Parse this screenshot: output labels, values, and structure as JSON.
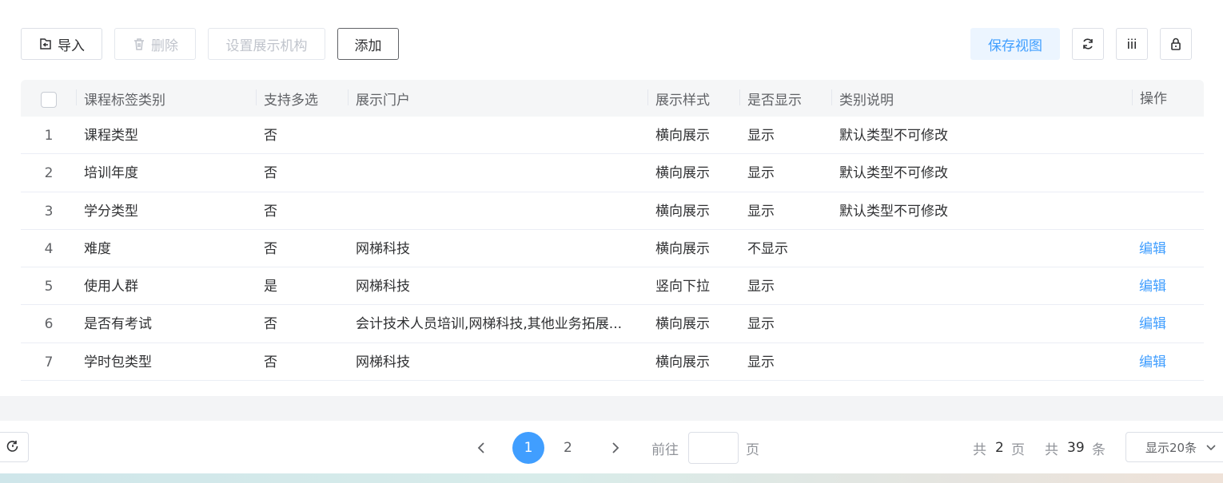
{
  "toolbar": {
    "import_label": "导入",
    "delete_label": "删除",
    "set_org_label": "设置展示机构",
    "add_label": "添加",
    "save_view_label": "保存视图"
  },
  "table": {
    "headers": {
      "category": "课程标签类别",
      "multi": "支持多选",
      "portal": "展示门户",
      "style": "展示样式",
      "display": "是否显示",
      "desc": "类别说明",
      "action": "操作"
    },
    "rows": [
      {
        "idx": "1",
        "category": "课程类型",
        "multi": "否",
        "portal": "",
        "style": "横向展示",
        "display": "显示",
        "desc": "默认类型不可修改",
        "action": ""
      },
      {
        "idx": "2",
        "category": "培训年度",
        "multi": "否",
        "portal": "",
        "style": "横向展示",
        "display": "显示",
        "desc": "默认类型不可修改",
        "action": ""
      },
      {
        "idx": "3",
        "category": "学分类型",
        "multi": "否",
        "portal": "",
        "style": "横向展示",
        "display": "显示",
        "desc": "默认类型不可修改",
        "action": ""
      },
      {
        "idx": "4",
        "category": "难度",
        "multi": "否",
        "portal": "网梯科技",
        "style": "横向展示",
        "display": "不显示",
        "desc": "",
        "action": "编辑"
      },
      {
        "idx": "5",
        "category": "使用人群",
        "multi": "是",
        "portal": "网梯科技",
        "style": "竖向下拉",
        "display": "显示",
        "desc": "",
        "action": "编辑"
      },
      {
        "idx": "6",
        "category": "是否有考试",
        "multi": "否",
        "portal": "会计技术人员培训,网梯科技,其他业务拓展...",
        "style": "横向展示",
        "display": "显示",
        "desc": "",
        "action": "编辑"
      },
      {
        "idx": "7",
        "category": "学时包类型",
        "multi": "否",
        "portal": "网梯科技",
        "style": "横向展示",
        "display": "显示",
        "desc": "",
        "action": "编辑"
      }
    ]
  },
  "pagination": {
    "current_page": "1",
    "next_page": "2",
    "goto_label": "前往",
    "page_unit": "页",
    "total_prefix": "共",
    "total_pages": "2",
    "total_pages_unit": "页",
    "total_items_prefix": "共",
    "total_items": "39",
    "total_items_unit": "条",
    "page_size": "显示20条"
  },
  "colors": {
    "primary": "#409eff",
    "header_bg": "#f5f6f7"
  }
}
